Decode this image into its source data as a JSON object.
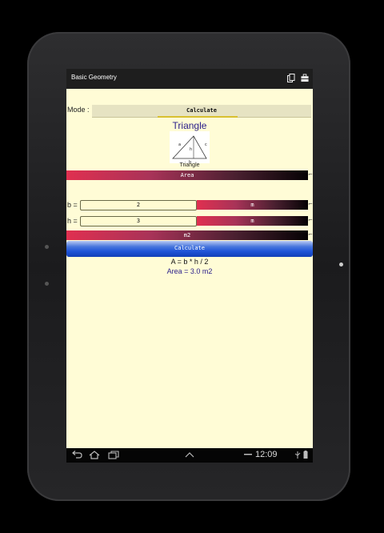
{
  "app": {
    "title": "Basic Geometry"
  },
  "mode": {
    "label": "Mode :",
    "button": "Calculate"
  },
  "shape": {
    "title": "Triangle",
    "caption": "Triangle",
    "diagram_labels": {
      "a": "a",
      "c": "c",
      "h": "h",
      "b": "b"
    }
  },
  "target_unit_bar": {
    "label": "Area"
  },
  "fields": [
    {
      "label": "b =",
      "value": "2",
      "unit": "m"
    },
    {
      "label": "h =",
      "value": "3",
      "unit": "m"
    }
  ],
  "result_unit_bar": {
    "label": "m2"
  },
  "calculate_button": "Calculate",
  "formula": "A = b * h / 2",
  "result": "Area = 3.0 m2",
  "status": {
    "clock": "12:09"
  }
}
